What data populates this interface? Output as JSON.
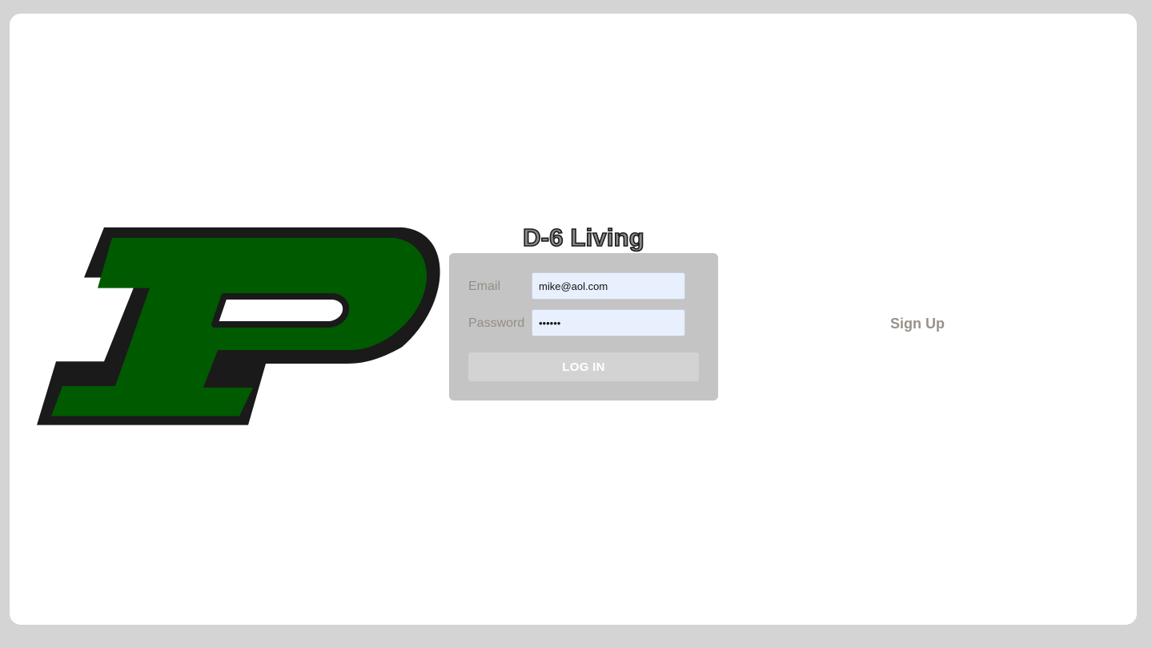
{
  "app": {
    "title": "D-6 Living"
  },
  "login_form": {
    "email_label": "Email",
    "email_value": "mike@aol.com",
    "password_label": "Password",
    "password_value": "••••••",
    "submit_label": "LOG IN"
  },
  "signup": {
    "label": "Sign Up"
  },
  "logo": {
    "icon": "letter-p-logo",
    "fill_color": "#005a00",
    "outline_color": "#1a1a1a"
  },
  "colors": {
    "background": "#d4d4d4",
    "card": "#c4c4c4",
    "input_fill": "#e8f0fe",
    "muted_text": "#958d86"
  }
}
